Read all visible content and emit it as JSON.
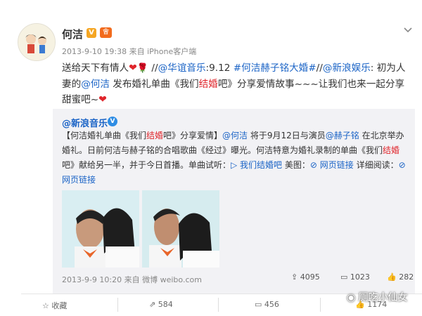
{
  "post": {
    "author": "何洁",
    "verified_badge": "V",
    "member_badge": "會",
    "timestamp": "2013-9-10 19:38 来自 iPhone客户端",
    "seg1": "送给天下有情人",
    "seg2": "//",
    "mention_hy": "@华谊音乐",
    "seg3": ":9.12 ",
    "hashtag": "#何洁赫子铭大婚#",
    "seg4": "//",
    "mention_xl": "@新浪娱乐",
    "seg5": ": 初为人妻的",
    "mention_hj": "@何洁",
    "seg6": " 发布婚礼单曲《我们",
    "seg6_red": "结婚",
    "seg7": "吧》分享爱情故事~~~让我们也来一起分享甜蜜吧~"
  },
  "repost": {
    "author": "@新浪音乐",
    "verified_badge": "V",
    "t1": "【何洁婚礼单曲《我们",
    "t1_red": "结婚",
    "t2": "吧》分享爱情】",
    "mention_hj": "@何洁",
    "t3": " 将于9月12日与演员",
    "mention_hzm": "@赫子铭",
    "t4": " 在北京举办婚礼。日前何洁与赫子铭的合唱歌曲《经过》曝光。何洁特意为婚礼录制的单曲《我们",
    "t4_red": "结婚",
    "t5": "吧》献给另一半，并于今日首播。单曲试听：",
    "link_song": "▷ 我们结婚吧",
    "t6": " 美图：",
    "link_web1": "网页链接",
    "t7": " 详细阅读：",
    "link_web2": "网页链接",
    "meta": "2013-9-9 10:20 来自 微博 weibo.com",
    "share_count": "4095",
    "comment_count": "1023",
    "like_count": "282"
  },
  "actions": {
    "favorite": "收藏",
    "forward": "584",
    "comment": "456",
    "like": "1174"
  },
  "watermark": "厕吃小仙女",
  "colors": {
    "link": "#1a63c6",
    "highlight": "#e0252b",
    "repost_bg": "#f2f2f5"
  }
}
